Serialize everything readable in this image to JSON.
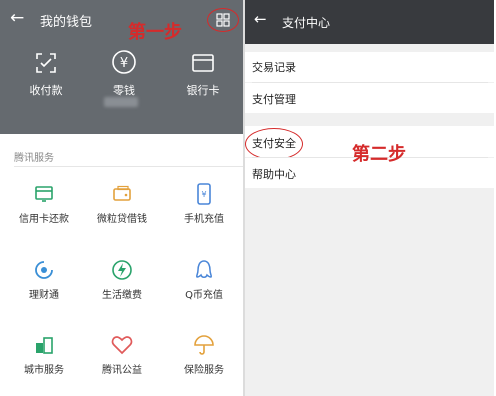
{
  "left": {
    "title": "我的钱包",
    "back_icon": "arrow-left-icon",
    "step_label": "第一步",
    "top_actions": [
      {
        "label": "收付款",
        "icon": "scan-qr-icon"
      },
      {
        "label": "零钱",
        "icon": "yuan-coin-icon"
      },
      {
        "label": "银行卡",
        "icon": "bank-card-icon"
      }
    ],
    "section_title": "腾讯服务",
    "services": [
      {
        "label": "信用卡还款",
        "icon": "credit-card-icon",
        "color": "#2aa36b"
      },
      {
        "label": "微粒贷借钱",
        "icon": "wallet-icon",
        "color": "#e3a13c"
      },
      {
        "label": "手机充值",
        "icon": "phone-icon",
        "color": "#4a86d8"
      },
      {
        "label": "理财通",
        "icon": "wealth-icon",
        "color": "#3a8fd6"
      },
      {
        "label": "生活缴费",
        "icon": "lightning-icon",
        "color": "#2aa36b"
      },
      {
        "label": "Q币充值",
        "icon": "penguin-icon",
        "color": "#4a86d8"
      },
      {
        "label": "城市服务",
        "icon": "city-icon",
        "color": "#2aa36b"
      },
      {
        "label": "腾讯公益",
        "icon": "heart-icon",
        "color": "#e05a5a"
      },
      {
        "label": "保险服务",
        "icon": "umbrella-icon",
        "color": "#e3a13c"
      }
    ]
  },
  "right": {
    "title": "支付中心",
    "back_icon": "arrow-left-icon",
    "group1": [
      "交易记录",
      "支付管理"
    ],
    "group2": [
      "支付安全",
      "帮助中心"
    ],
    "step_label": "第二步"
  },
  "colors": {
    "annotation": "#d52b2b",
    "left_header": "#656a6f",
    "right_header": "#383a3e"
  }
}
